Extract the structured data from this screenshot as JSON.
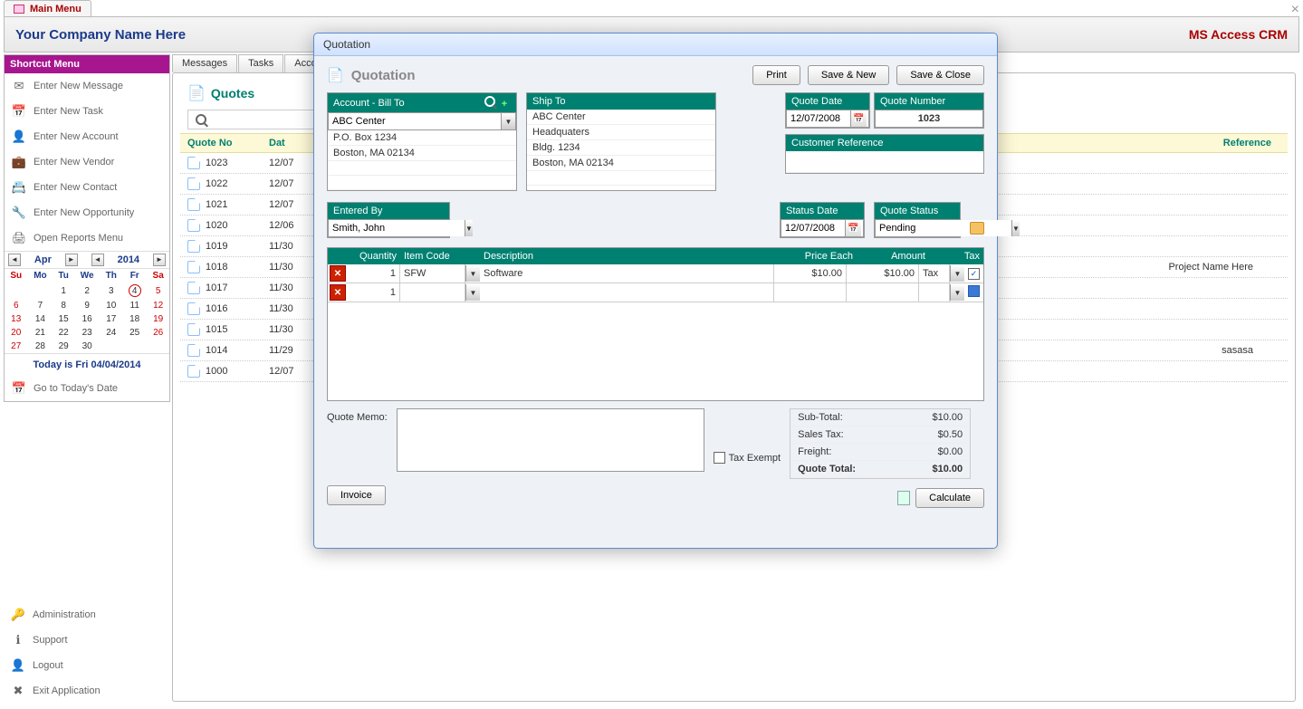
{
  "window": {
    "title": "Main Menu",
    "close": "×"
  },
  "banner": {
    "company": "Your Company Name Here",
    "app": "MS Access CRM"
  },
  "sidebar": {
    "title": "Shortcut Menu",
    "items": [
      {
        "label": "Enter New Message",
        "icon": "✉"
      },
      {
        "label": "Enter New Task",
        "icon": "📅"
      },
      {
        "label": "Enter New Account",
        "icon": "👤"
      },
      {
        "label": "Enter New Vendor",
        "icon": "💼"
      },
      {
        "label": "Enter New Contact",
        "icon": "📇"
      },
      {
        "label": "Enter New Opportunity",
        "icon": "🔧"
      },
      {
        "label": "Open Reports Menu",
        "icon": "🖨"
      }
    ],
    "bottom": [
      {
        "label": "Administration",
        "icon": "🔑"
      },
      {
        "label": "Support",
        "icon": "ℹ"
      },
      {
        "label": "Logout",
        "icon": "👤"
      },
      {
        "label": "Exit Application",
        "icon": "✖"
      }
    ],
    "cal": {
      "month": "Apr",
      "year": "2014",
      "dow": [
        "Su",
        "Mo",
        "Tu",
        "We",
        "Th",
        "Fr",
        "Sa"
      ],
      "weeks": [
        [
          "",
          "",
          "1",
          "2",
          "3",
          "4",
          "5"
        ],
        [
          "6",
          "7",
          "8",
          "9",
          "10",
          "11",
          "12"
        ],
        [
          "13",
          "14",
          "15",
          "16",
          "17",
          "18",
          "19"
        ],
        [
          "20",
          "21",
          "22",
          "23",
          "24",
          "25",
          "26"
        ],
        [
          "27",
          "28",
          "29",
          "30",
          "",
          "",
          ""
        ]
      ],
      "today_cell": "4",
      "today_line": "Today is Fri 04/04/2014",
      "goto": "Go to Today's Date"
    }
  },
  "tabs": [
    "Messages",
    "Tasks",
    "Accounts"
  ],
  "listing": {
    "title": "Quotes",
    "headers": {
      "qno": "Quote No",
      "date": "Dat",
      "ref": "Reference"
    },
    "rows": [
      {
        "no": "1023",
        "date": "12/07",
        "ref": ""
      },
      {
        "no": "1022",
        "date": "12/07",
        "ref": ""
      },
      {
        "no": "1021",
        "date": "12/07",
        "ref": ""
      },
      {
        "no": "1020",
        "date": "12/06",
        "ref": ""
      },
      {
        "no": "1019",
        "date": "11/30",
        "ref": ""
      },
      {
        "no": "1018",
        "date": "11/30",
        "ref": "Project Name Here"
      },
      {
        "no": "1017",
        "date": "11/30",
        "ref": ""
      },
      {
        "no": "1016",
        "date": "11/30",
        "ref": ""
      },
      {
        "no": "1015",
        "date": "11/30",
        "ref": ""
      },
      {
        "no": "1014",
        "date": "11/29",
        "ref": "sasasa"
      },
      {
        "no": "1000",
        "date": "12/07",
        "ref": ""
      }
    ]
  },
  "dialog": {
    "winTitle": "Quotation",
    "title": "Quotation",
    "buttons": {
      "print": "Print",
      "saveNew": "Save & New",
      "saveClose": "Save & Close"
    },
    "billTo": {
      "hdr": "Account - Bill To",
      "lines": [
        "ABC Center",
        "P.O. Box 1234",
        "Boston, MA  02134"
      ]
    },
    "shipTo": {
      "hdr": "Ship To",
      "lines": [
        "ABC Center",
        "Headquaters",
        "Bldg. 1234",
        "Boston, MA  02134"
      ]
    },
    "quoteDate": {
      "hdr": "Quote Date",
      "val": "12/07/2008"
    },
    "quoteNumber": {
      "hdr": "Quote Number",
      "val": "1023"
    },
    "custRef": {
      "hdr": "Customer Reference",
      "val": ""
    },
    "enteredBy": {
      "hdr": "Entered By",
      "val": "Smith, John"
    },
    "statusDate": {
      "hdr": "Status Date",
      "val": "12/07/2008"
    },
    "quoteStatus": {
      "hdr": "Quote Status",
      "val": "Pending"
    },
    "lineHdr": {
      "qty": "Quantity",
      "code": "Item Code",
      "desc": "Description",
      "price": "Price Each",
      "amt": "Amount",
      "tax": "Tax"
    },
    "lines": [
      {
        "qty": "1",
        "code": "SFW",
        "desc": "Software",
        "price": "$10.00",
        "amt": "$10.00",
        "tax": "Tax",
        "checked": true
      },
      {
        "qty": "1",
        "code": "",
        "desc": "",
        "price": "",
        "amt": "",
        "tax": "",
        "checked": false,
        "blueSquare": true
      }
    ],
    "memoLabel": "Quote Memo:",
    "taxExempt": "Tax Exempt",
    "calculate": "Calculate",
    "invoice": "Invoice",
    "totals": {
      "subtotal": {
        "lbl": "Sub-Total:",
        "val": "$10.00"
      },
      "salestax": {
        "lbl": "Sales Tax:",
        "val": "$0.50"
      },
      "freight": {
        "lbl": "Freight:",
        "val": "$0.00"
      },
      "total": {
        "lbl": "Quote Total:",
        "val": "$10.00"
      }
    }
  }
}
